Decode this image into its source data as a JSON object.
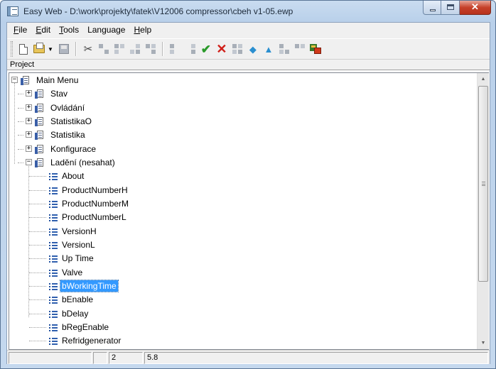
{
  "window": {
    "title": "Easy Web - D:\\work\\projekty\\fatek\\V12006 compressor\\cbeh v1-05.ewp"
  },
  "menu": {
    "items": [
      {
        "key": "file",
        "underline": "F",
        "rest": "ile"
      },
      {
        "key": "edit",
        "underline": "E",
        "rest": "dit"
      },
      {
        "key": "tools",
        "underline": "T",
        "rest": "ools"
      },
      {
        "key": "language",
        "underline": "",
        "rest": "Language"
      },
      {
        "key": "help",
        "underline": "H",
        "rest": "elp"
      }
    ]
  },
  "toolbar": {
    "icons": [
      "new-document-icon",
      "open-folder-icon",
      "save-icon",
      "cut-icon",
      "copy-icon",
      "paste-icon",
      "check-icon",
      "delete-icon",
      "move-down-icon",
      "move-up-icon"
    ],
    "accept_glyph": "✔",
    "reject_glyph": "✕",
    "cut_glyph": "✂"
  },
  "pane": {
    "header": "Project"
  },
  "tree": {
    "root": "Main Menu",
    "folders": [
      "Stav",
      "Ovládání",
      "StatistikaO",
      "Statistika",
      "Konfigurace",
      "Ladění (nesahat)"
    ],
    "items": [
      "About",
      "ProductNumberH",
      "ProductNumberM",
      "ProductNumberL",
      "VersionH",
      "VersionL",
      "Up Time",
      "Valve",
      "bWorkingTime",
      "bEnable",
      "bDelay",
      "bRegEnable",
      "Refridgenerator"
    ],
    "selected": "bWorkingTime"
  },
  "status": {
    "cell1": "",
    "cell2": "",
    "cell3": "2",
    "cell4": "5.8"
  },
  "colors": {
    "selection": "#3399ff",
    "titlebar": "#c9dcf0",
    "close_button": "#c6412a"
  }
}
